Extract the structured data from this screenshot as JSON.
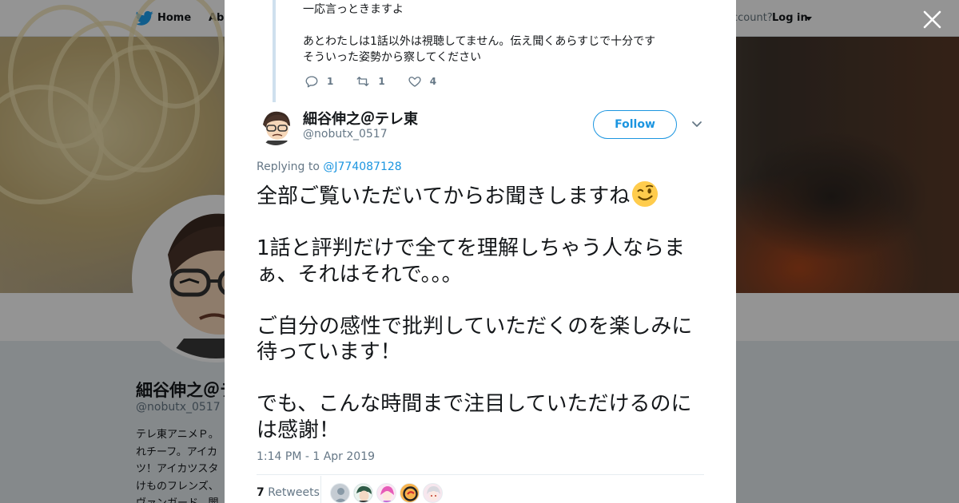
{
  "nav": {
    "home_label": "Home",
    "about_label": "Abo",
    "account_prompt": "ccount?",
    "login_label": "Log in"
  },
  "profile": {
    "name": "細谷伸之＠テ",
    "handle": "@nobutx_0517",
    "bio": "テレ東アニメＰ。\nれチーフ。アイカ\nツ！アイカツスタ\nけものフレンズ、\nヴァンガード、闇"
  },
  "previous_tweet": {
    "text": "一応言っときますよ\n\nあとわたしは1話以外は視聴してません。伝え聞くあらすじで十分です\nそういった姿勢から察してください",
    "replies": "1",
    "retweets": "1",
    "likes": "4"
  },
  "tweet": {
    "author_name": "細谷伸之＠テレ東",
    "author_handle": "@nobutx_0517",
    "follow_label": "Follow",
    "replying_prefix": "Replying to",
    "replying_to": "@J774087128",
    "paragraphs": [
      "全部ご覧いただいてからお聞きしますね",
      "1話と評判だけで全てを理解しちゃう人ならまぁ、それはそれで。。。",
      "ご自分の感性で批判していただくのを楽しみに待っています！",
      "でも、こんな時間まで注目していただけるのには感謝！"
    ],
    "timestamp": "1:14 PM - 1 Apr 2019",
    "retweet_count": "7",
    "retweet_label": "Retweets"
  },
  "colors": {
    "accent": "#1b95e0",
    "twitter_blue": "#1da1f2",
    "text_primary": "#14171a",
    "text_secondary": "#657786",
    "thread_line": "#cfe0ee"
  },
  "icons": [
    "twitter-bird-icon",
    "close-icon",
    "reply-icon",
    "retweet-icon",
    "like-icon",
    "chevron-down-icon",
    "wink-emoji-icon"
  ]
}
